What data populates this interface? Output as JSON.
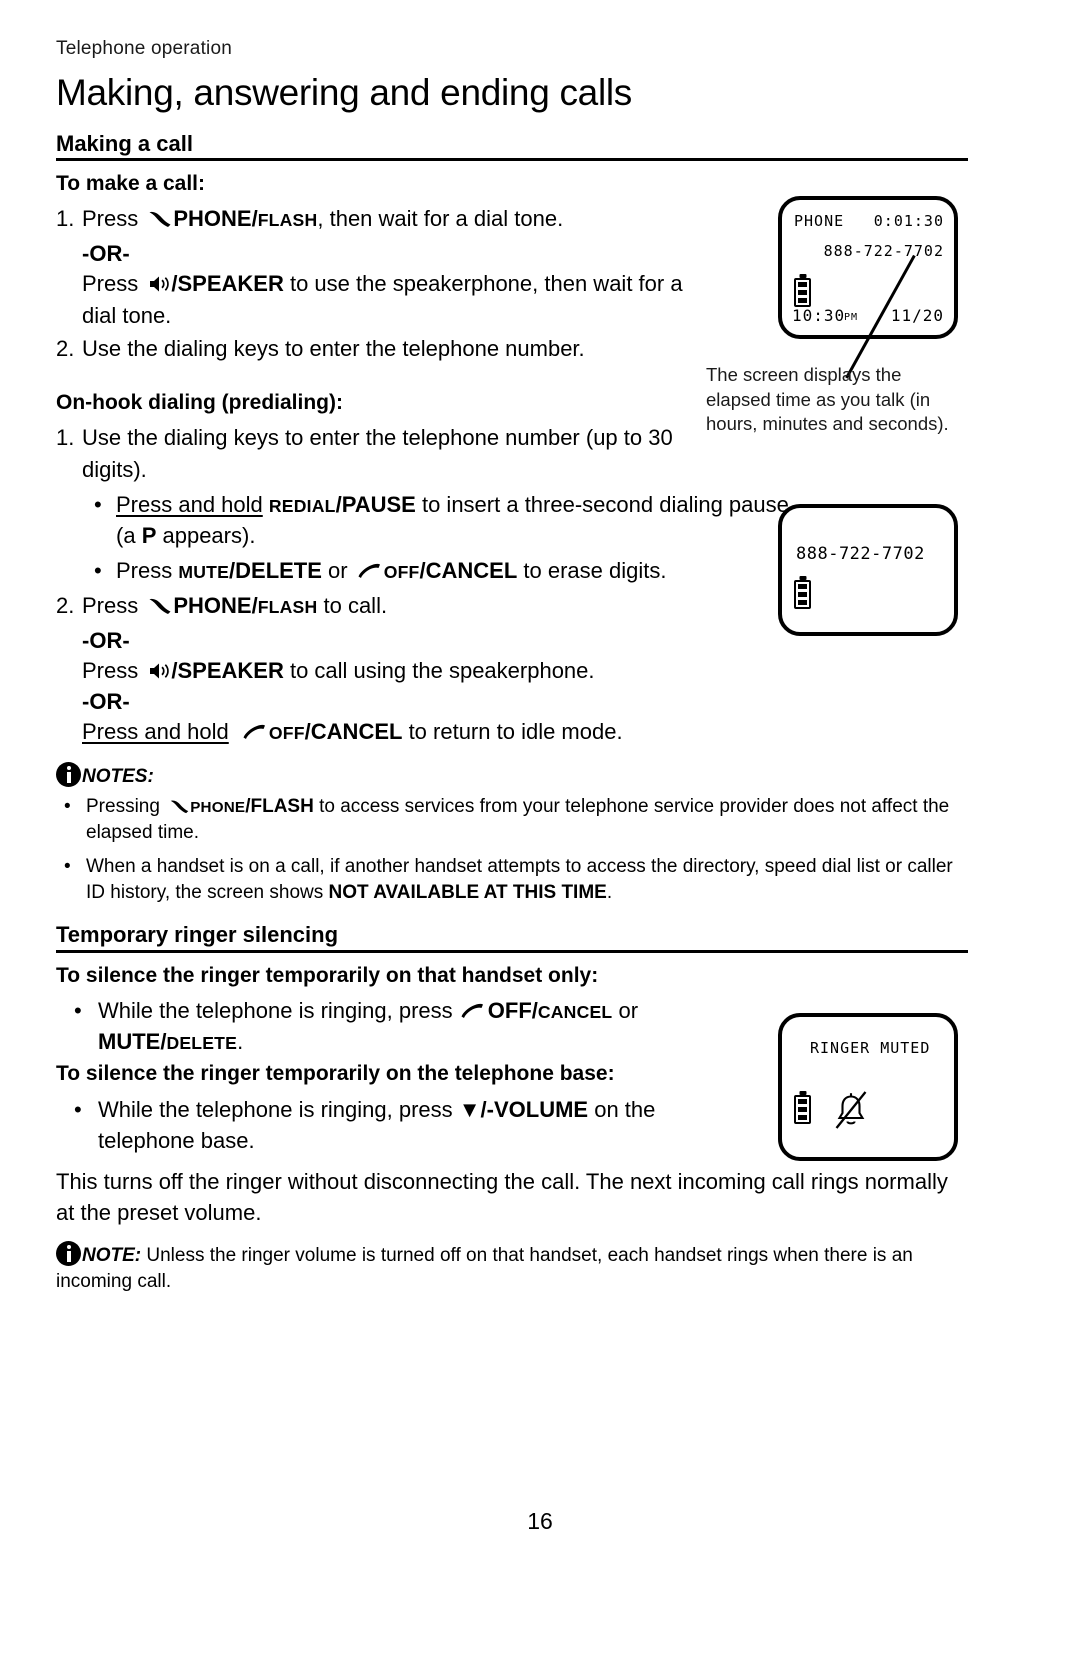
{
  "header": {
    "running_head": "Telephone operation",
    "chapter_title": "Making, answering and ending calls"
  },
  "sections": {
    "making_a_call": {
      "section_head": "Making a call",
      "sub_head": "To make a call:",
      "step1_num": "1.",
      "step1_press": "Press",
      "step1_key_bold": "PHONE/",
      "step1_key_sc": "FLASH",
      "step1_tail": ", then wait for a dial tone.",
      "or_1": "-OR-",
      "step1b_press": "Press",
      "step1b_key": "/SPEAKER",
      "step1b_tail": " to use the speakerphone, then wait for a dial tone.",
      "step2_num": "2.",
      "step2_text": "Use the dialing keys to enter the telephone number."
    },
    "on_hook": {
      "sub_head": "On-hook dialing (predialing):",
      "step1_num": "1.",
      "step1_text": "Use the dialing keys to enter the telephone number (up to 30 digits).",
      "bullet1_hold": "Press and hold",
      "bullet1_key_sc": "REDIAL",
      "bullet1_key_bold": "/PAUSE",
      "bullet1_tail": " to insert a three-second dialing pause (a ",
      "bullet1_p": "P",
      "bullet1_tail2": " appears).",
      "bullet2_press": "Press ",
      "bullet2_key_sc": "MUTE",
      "bullet2_key_bold": "/DELETE",
      "bullet2_mid": " or ",
      "bullet2_key2_sc": "OFF",
      "bullet2_key2_bold": "/CANCEL",
      "bullet2_tail": " to erase digits.",
      "step2_num": "2.",
      "step2_press": "Press",
      "step2_key_bold": "PHONE/",
      "step2_key_sc": "FLASH",
      "step2_tail": " to call.",
      "or_1": "-OR-",
      "step2b_press": "Press",
      "step2b_key": "/SPEAKER",
      "step2b_tail": " to call using the speakerphone.",
      "or_2": "-OR-",
      "step2c_hold": "Press and hold",
      "step2c_key_sc": "OFF",
      "step2c_key_bold": "/CANCEL",
      "step2c_tail": " to return to idle mode."
    },
    "notes_1": {
      "label": "NOTES:",
      "bullet_dot": "•",
      "b1_lead": "Pressing",
      "b1_key_sc": "PHONE",
      "b1_key_bold": "/FLASH",
      "b1_tail": " to access services from your telephone service provider does not affect the elapsed time.",
      "b2_text": "When a handset is on a call, if another handset attempts to access the directory, speed dial list or caller ID history, the screen shows ",
      "b2_bold": "NOT AVAILABLE AT THIS TIME",
      "b2_tail": "."
    },
    "ringer_silencing": {
      "section_head": "Temporary ringer silencing",
      "sub_head_1": "To silence the ringer temporarily on that handset only:",
      "bullet1_lead": "While the telephone is ringing, press ",
      "bullet1_key_bold": "OFF/",
      "bullet1_key_sc": "CANCEL",
      "bullet1_or": " or",
      "bullet1_key2_bold": "MUTE/",
      "bullet1_key2_sc": "DELETE",
      "bullet1_period": ".",
      "sub_head_2": "To silence the ringer temporarily on the telephone base:",
      "bullet2_lead": "While the telephone is ringing, press ",
      "bullet2_key": "▼/-VOLUME",
      "bullet2_tail": " on the telephone base.",
      "para": "This turns off the ringer without disconnecting the call. The next incoming call rings normally at the preset volume."
    },
    "note_2": {
      "label": "NOTE:",
      "text": " Unless the ringer volume is turned off on that handset, each handset rings when there is an incoming call."
    }
  },
  "lcd_screens": {
    "call_screen": {
      "line_mode": "PHONE",
      "elapsed": "0:01:30",
      "number": "888-722-7702",
      "time": "10:30",
      "time_meridiem": "PM",
      "date": "11/20",
      "battery_icon": "battery-icon"
    },
    "predial_screen": {
      "number": "888-722-7702",
      "battery_icon": "battery-icon"
    },
    "ringer_muted_screen": {
      "status": "RINGER MUTED",
      "battery_icon": "battery-icon",
      "bell_icon": "bell-muted-icon"
    }
  },
  "captions": {
    "elapsed_time": "The screen displays the elapsed time as you talk (in hours, minutes and seconds)."
  },
  "footer": {
    "page_number": "16"
  },
  "colors": {
    "ink": "#000000",
    "paper": "#ffffff"
  }
}
